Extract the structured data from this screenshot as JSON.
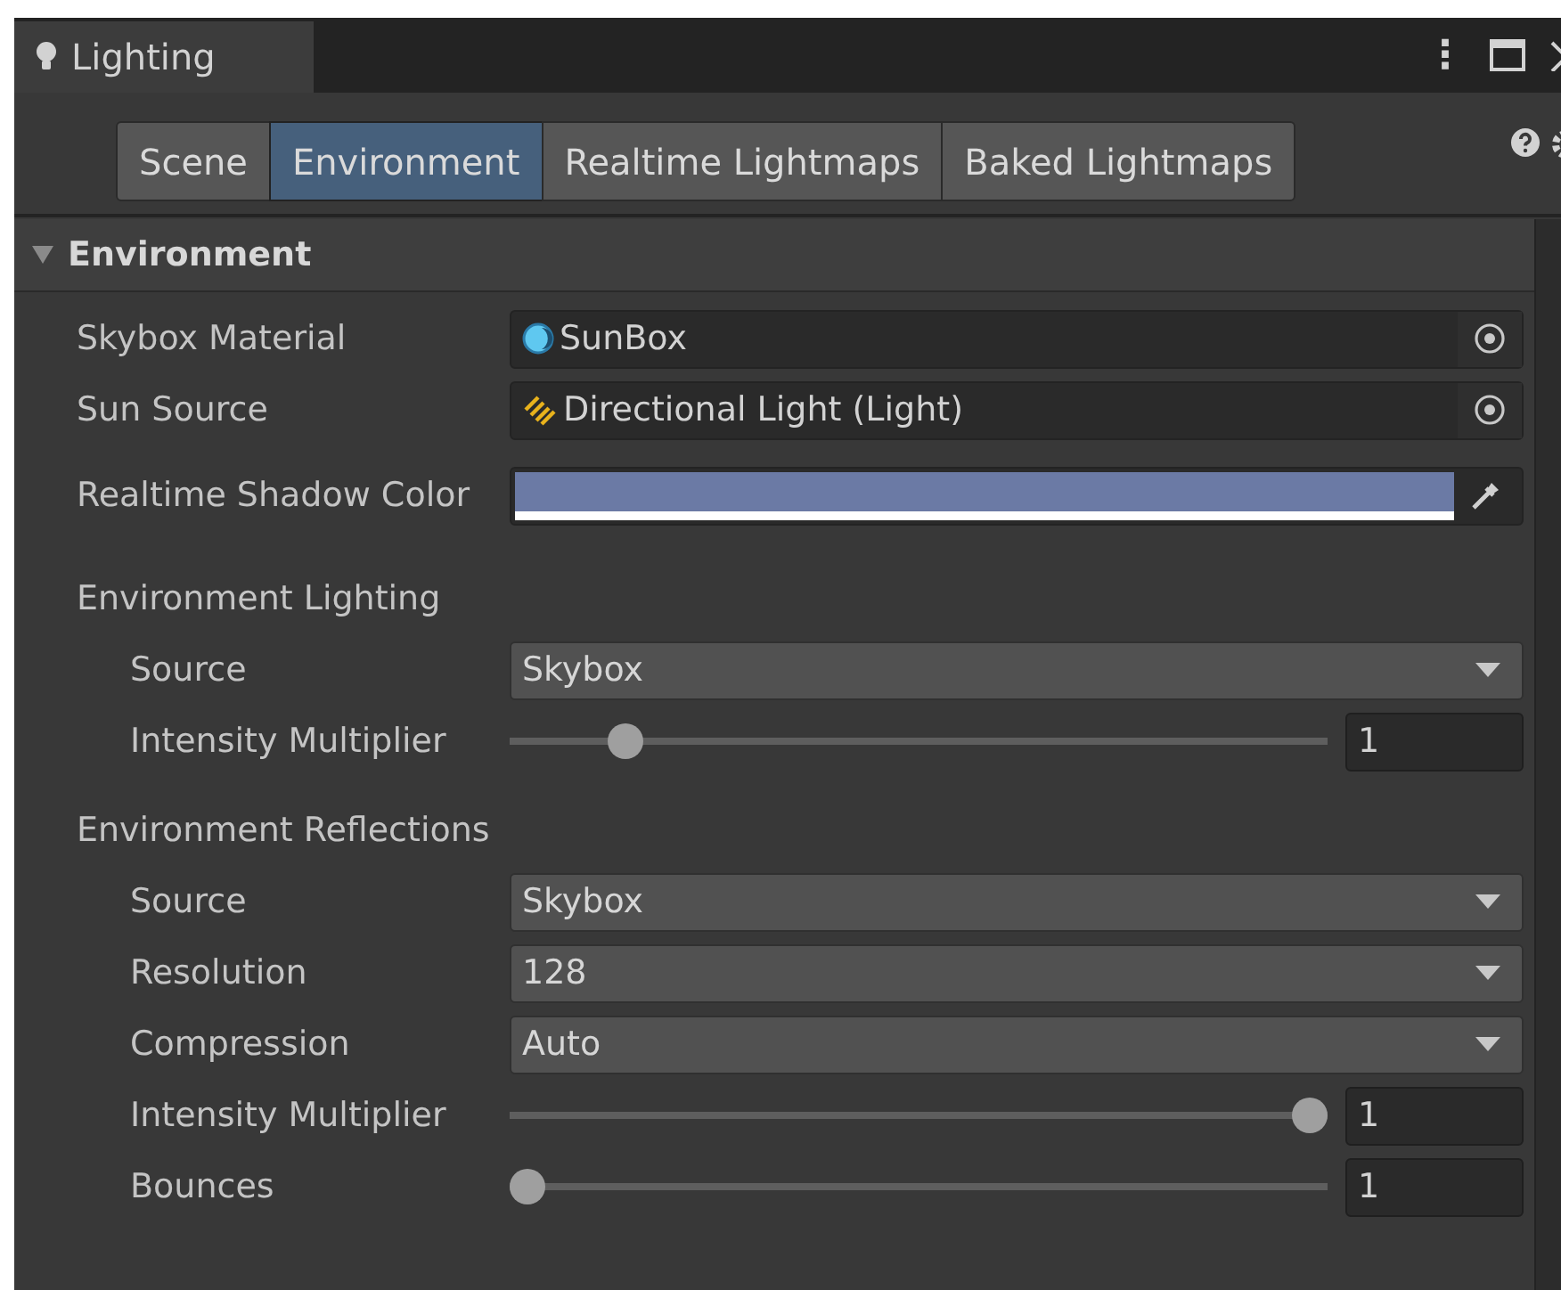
{
  "window": {
    "title": "Lighting",
    "menu_glyph": "⋮"
  },
  "tabs": [
    {
      "label": "Scene",
      "selected": false
    },
    {
      "label": "Environment",
      "selected": true
    },
    {
      "label": "Realtime Lightmaps",
      "selected": false
    },
    {
      "label": "Baked Lightmaps",
      "selected": false
    }
  ],
  "section": {
    "title": "Environment",
    "expanded": true,
    "rows": [
      {
        "kind": "object",
        "label": "Skybox Material",
        "value": "SunBox"
      },
      {
        "kind": "object",
        "label": "Sun Source",
        "value": "Directional Light (Light)"
      },
      {
        "kind": "color",
        "label": "Realtime Shadow Color",
        "color": "#6b7aa5"
      },
      {
        "kind": "group",
        "label": "Environment Lighting",
        "children": [
          {
            "kind": "dropdown",
            "label": "Source",
            "value": "Skybox"
          },
          {
            "kind": "slider",
            "label": "Intensity Multiplier",
            "level": 0.125,
            "value": "1"
          }
        ]
      },
      {
        "kind": "group",
        "label": "Environment Reflections",
        "children": [
          {
            "kind": "dropdown",
            "label": "Source",
            "value": "Skybox"
          },
          {
            "kind": "dropdown",
            "label": "Resolution",
            "value": "128"
          },
          {
            "kind": "dropdown",
            "label": "Compression",
            "value": "Auto"
          },
          {
            "kind": "slider",
            "label": "Intensity Multiplier",
            "level": 1,
            "value": "1"
          },
          {
            "kind": "slider",
            "label": "Bounces",
            "level": 0,
            "value": "1"
          }
        ]
      }
    ]
  }
}
